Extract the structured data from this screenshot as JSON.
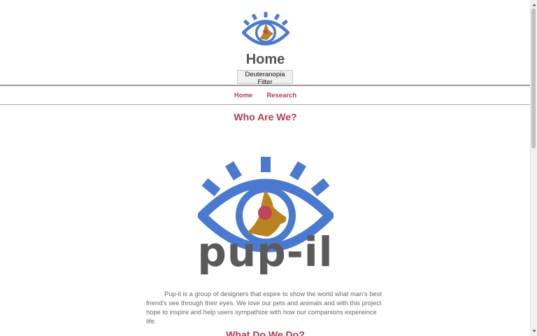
{
  "header": {
    "title": "Home",
    "filter_button_label": "Deuteranopia Filter"
  },
  "nav": {
    "items": [
      {
        "label": "Home"
      },
      {
        "label": "Research"
      }
    ]
  },
  "about": {
    "title": "Who Are We?",
    "brand_name": "pup-il",
    "description": "Pup-il is a group of designers that espire to show the world what man's best friend's see through their eyes. We love our pets and animals and with this project hope to inspire and help users sympathize with how our companions expereince life."
  },
  "next_section": {
    "title": "What Do We Do?"
  },
  "colors": {
    "accent": "#b53a4e",
    "logo_blue": "#4a7ad0",
    "logo_gold": "#b8841f",
    "logo_red": "#c0465a",
    "text_gray": "#555555"
  },
  "icons": {
    "logo": "eye-logo-icon"
  }
}
